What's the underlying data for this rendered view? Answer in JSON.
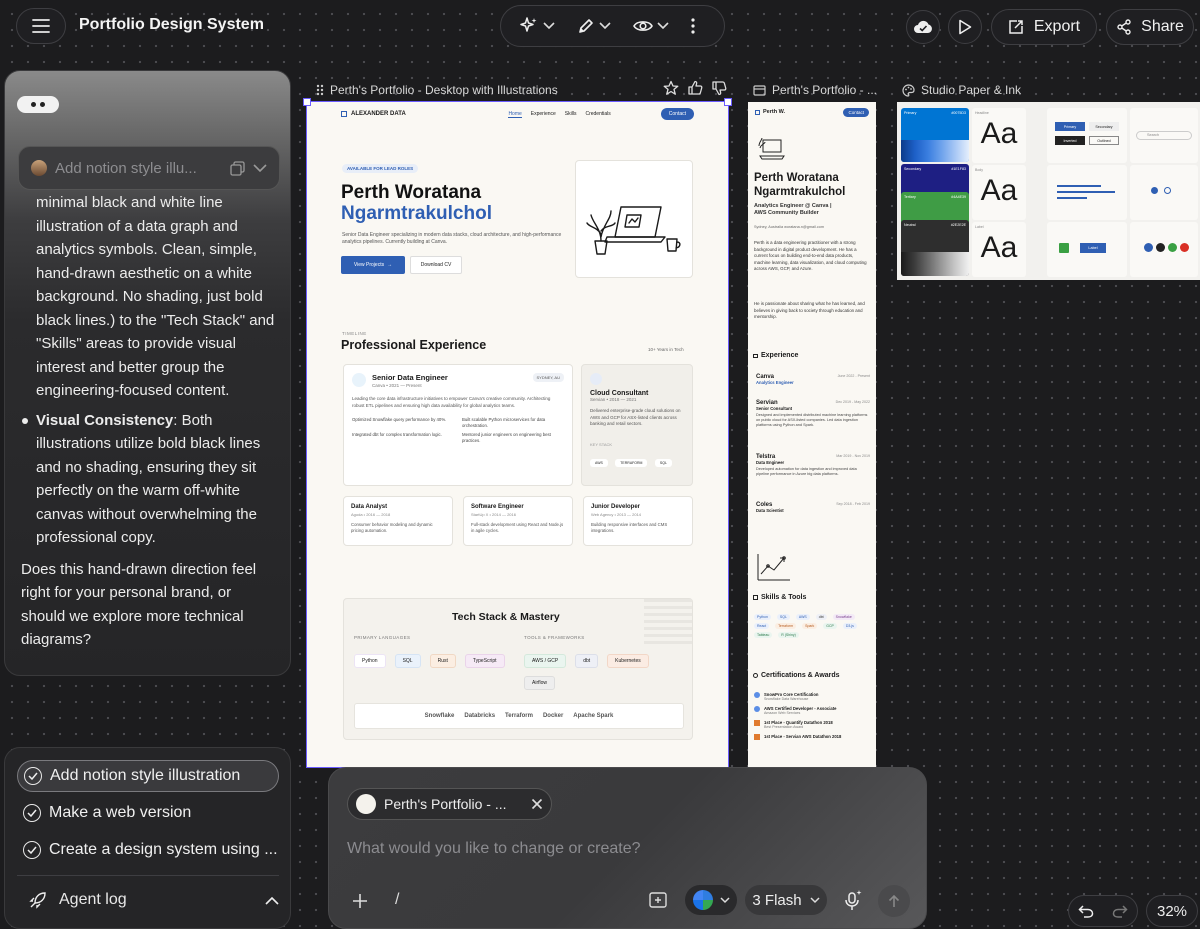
{
  "header": {
    "title": "Portfolio Design System",
    "export_label": "Export",
    "share_label": "Share"
  },
  "chat": {
    "input_placeholder": "Add notion style illu...",
    "lines_top": [
      "minimal black and white line",
      "illustration of a data graph and",
      "analytics symbols. Clean, simple,",
      "hand-drawn aesthetic on a white",
      "background. No shading, just bold",
      "black lines.) to the \"Tech Stack\" and",
      "\"Skills\" areas to provide visual",
      "interest and better group the",
      "engineering-focused content."
    ],
    "bullet_title": "Visual Consistency",
    "bullet_lines": [
      ": Both",
      "illustrations utilize bold black lines",
      "and no shading, ensuring they sit",
      "perfectly on the warm off-white",
      "canvas without overwhelming the",
      "professional copy."
    ],
    "question_lines": [
      "Does this hand-drawn direction feel",
      "right for your personal brand, or",
      "should we explore more technical",
      "diagrams?"
    ]
  },
  "suggestions": {
    "items": [
      "Add notion style illustration",
      "Make a web version",
      "Create a design system using ..."
    ],
    "agent_log": "Agent log"
  },
  "frames": {
    "desktop": {
      "label": "Perth's Portfolio - Desktop with Illustrations",
      "brand": "ALEXANDER DATA",
      "nav": [
        "Home",
        "Experience",
        "Skills",
        "Credentials"
      ],
      "contact": "Contact",
      "badge": "AVAILABLE FOR LEAD ROLES",
      "name1": "Perth Woratana",
      "name2": "Ngarmtrakulchol",
      "intro": "Senior Data Engineer specializing in modern data stacks, cloud architecture, and high-performance analytics pipelines. Currently building at Canva.",
      "view_projects": "View Projects",
      "download_cv": "Download CV",
      "timeline": "TIMELINE",
      "exp_title": "Professional Experience",
      "years": "10+ Years in Tech",
      "job1": {
        "title": "Senior Data Engineer",
        "meta": "Canva • 2021 — Present",
        "loc": "SYDNEY, AU",
        "desc": "Leading the core data infrastructure initiatives to empower Canva's creative community. Architecting robust ETL pipelines and ensuring high data availability for global analytics teams.",
        "b1": "Optimized Snowflake query performance by 40%.",
        "b2": "Built scalable Python microservices for data orchestration.",
        "b3": "Integrated dbt for complex transformation logic.",
        "b4": "Mentored junior engineers on engineering best practices."
      },
      "job2": {
        "title": "Cloud Consultant",
        "meta": "Servian • 2018 — 2021",
        "desc": "Delivered enterprise-grade cloud solutions on AWS and GCP for ASX-listed clients across banking and retail sectors.",
        "key": "KEY STACK",
        "tags": [
          "AWS",
          "TERRAFORM",
          "SQL"
        ]
      },
      "small_jobs": [
        {
          "title": "Data Analyst",
          "meta": "Agoda • 2016 — 2018",
          "desc": "Consumer behavior modeling and dynamic pricing automation."
        },
        {
          "title": "Software Engineer",
          "meta": "StartUp X • 2014 — 2016",
          "desc": "Full-stack development using React and Node.js in agile cycles."
        },
        {
          "title": "Junior Developer",
          "meta": "Web Agency • 2013 — 2014",
          "desc": "Building responsive interfaces and CMS integrations."
        }
      ],
      "tech_title": "Tech Stack & Mastery",
      "primary_lang": "PRIMARY LANGUAGES",
      "tools_fw": "TOOLS & FRAMEWORKS",
      "langs": [
        "Python",
        "SQL",
        "Rust",
        "TypeScript"
      ],
      "tools": [
        "AWS / GCP",
        "dbt",
        "Kubernetes",
        "Airflow"
      ],
      "logos": [
        "Snowflake",
        "Databricks",
        "Terraform",
        "Docker",
        "Apache Spark"
      ]
    },
    "mobile": {
      "label": "Perth's Portfolio - ...",
      "brand": "Perth W.",
      "contact": "Contact",
      "name1": "Perth Woratana",
      "name2": "Ngarmtrakulchol",
      "role": "Analytics Engineer @ Canva |",
      "role2": "AWS Community Builder",
      "contact_line": "Sydney, Australia   woratana.n@gmail.com",
      "bio1": "Perth is a data engineering practitioner with a strong background in digital product development. He has a current focus on building end-to-end data products, machine learning, data visualization, and cloud computing across AWS, GCP, and Azure.",
      "bio2": "He is passionate about sharing what he has learned, and believes in giving back to society through education and mentorship.",
      "experience": "Experience",
      "jobs": [
        {
          "co": "Canva",
          "role": "Analytics Engineer",
          "date": "June 2022 - Present",
          "desc": ""
        },
        {
          "co": "Servian",
          "role": "Senior Consultant",
          "date": "Dec 2019 - May 2022",
          "desc": "Designed and implemented distributed machine learning platforms on public cloud for ASX-listed companies. Led data ingestion platforms using Python and Spark."
        },
        {
          "co": "Telstra",
          "role": "Data Engineer",
          "date": "Mar 2019 - Nov 2019",
          "desc": "Developed automation for data ingestion and improved data pipeline performance in Azure big data platforms."
        },
        {
          "co": "Coles",
          "role": "Data Scientist",
          "date": "Sep 2018 - Feb 2019",
          "desc": ""
        }
      ],
      "skills": "Skills & Tools",
      "skill_tags": [
        "Python",
        "SQL",
        "AWS",
        "dbt",
        "Snowflake",
        "React",
        "Terraform",
        "Spark",
        "GCP",
        "D3.js",
        "Tableau",
        "R (Shiny)"
      ],
      "certs": "Certifications & Awards",
      "cert_items": [
        {
          "t": "SnowPro Core Certification",
          "s": "Snowflake Data Warehouse"
        },
        {
          "t": "AWS Certified Developer - Associate",
          "s": "Amazon Web Services"
        },
        {
          "t": "1st Place - Quantify Datathon 2018",
          "s": "Best Presentation Award"
        },
        {
          "t": "1st Place - Servian AWS Datathon 2018",
          "s": ""
        }
      ]
    },
    "studio": {
      "label": "Studio Paper & Ink",
      "swatches": [
        {
          "name": "Primary",
          "hex": "#0075D3"
        },
        {
          "name": "Secondary",
          "hex": "#1E1F83"
        },
        {
          "name": "Tertiary",
          "hex": "#4A4E39"
        },
        {
          "name": "Neutral",
          "hex": "#2E2E2E"
        }
      ],
      "type_labels": [
        "Headline",
        "Body",
        "Label"
      ],
      "aa": "Aa",
      "buttons": [
        "Primary",
        "Secondary",
        "Inverted",
        "Outlined"
      ],
      "search": "Search",
      "label_btn": "Label"
    }
  },
  "composer": {
    "attachment": "Perth's Portfolio - ...",
    "placeholder": "What would you like to change or create?",
    "model": "3 Flash",
    "slash": "/"
  },
  "zoom": "32%",
  "colors": {
    "accent": "#2f5fb3",
    "selection": "#6b5cff"
  }
}
